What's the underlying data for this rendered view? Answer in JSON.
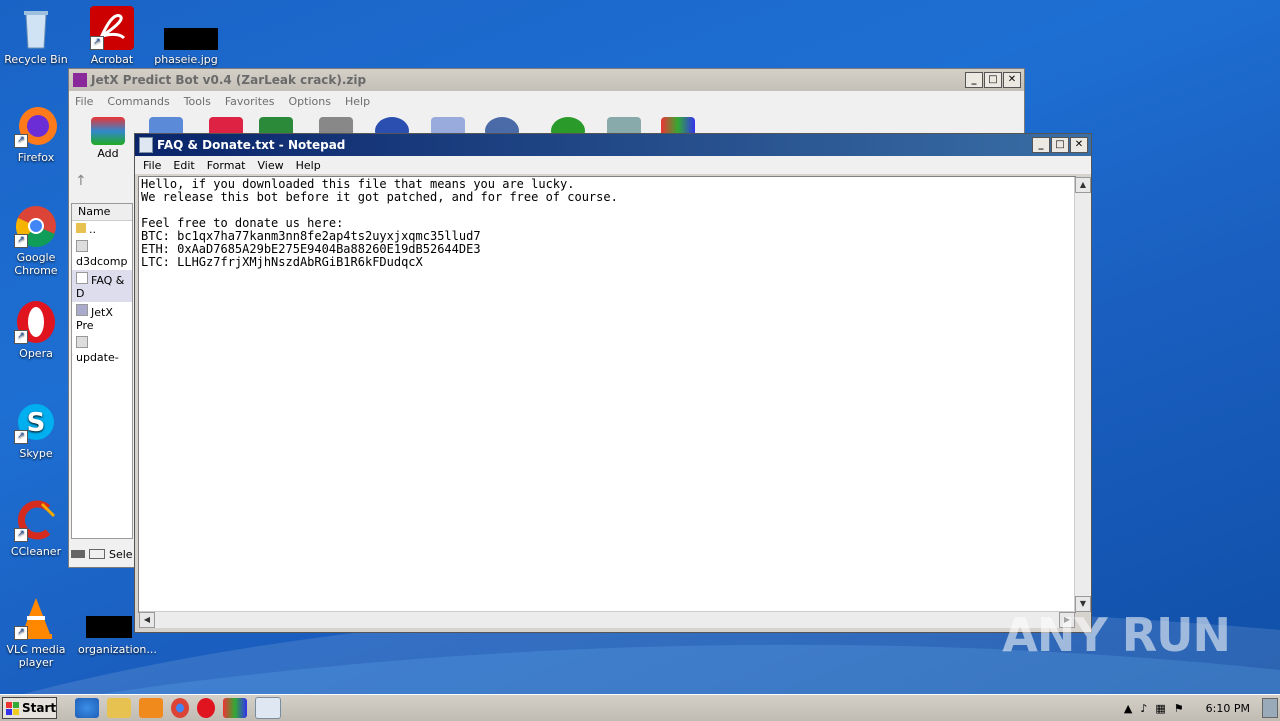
{
  "desktop": {
    "icons": [
      {
        "label": "Recycle Bin"
      },
      {
        "label": "Acrobat"
      },
      {
        "label": "phaseie.jpg"
      },
      {
        "label": "Firefox"
      },
      {
        "label": "Google Chrome"
      },
      {
        "label": "Opera"
      },
      {
        "label": "Skype"
      },
      {
        "label": "CCleaner"
      },
      {
        "label": "VLC media player"
      },
      {
        "label": "organization..."
      }
    ],
    "watermark": "ANY RUN"
  },
  "winrar": {
    "title": "JetX Predict Bot v0.4 (ZarLeak crack).zip",
    "menu": [
      "File",
      "Commands",
      "Tools",
      "Favorites",
      "Options",
      "Help"
    ],
    "add_label": "Add",
    "column_name": "Name",
    "files": [
      "..",
      "d3dcomp",
      "FAQ & D",
      "JetX Pre",
      "update-"
    ],
    "status": "Sele"
  },
  "notepad": {
    "title": "FAQ & Donate.txt - Notepad",
    "menu": [
      "File",
      "Edit",
      "Format",
      "View",
      "Help"
    ],
    "content": "Hello, if you downloaded this file that means you are lucky.\nWe release this bot before it got patched, and for free of course.\n\nFeel free to donate us here:\nBTC: bc1qx7ha77kanm3nn8fe2ap4ts2uyxjxqmc35llud7\nETH: 0xAaD7685A29bE275E9404Ba88260E19dB52644DE3\nLTC: LLHGz7frjXMjhNszdAbRGiB1R6kFDudqcX"
  },
  "taskbar": {
    "start_label": "Start",
    "clock": "6:10 PM"
  }
}
